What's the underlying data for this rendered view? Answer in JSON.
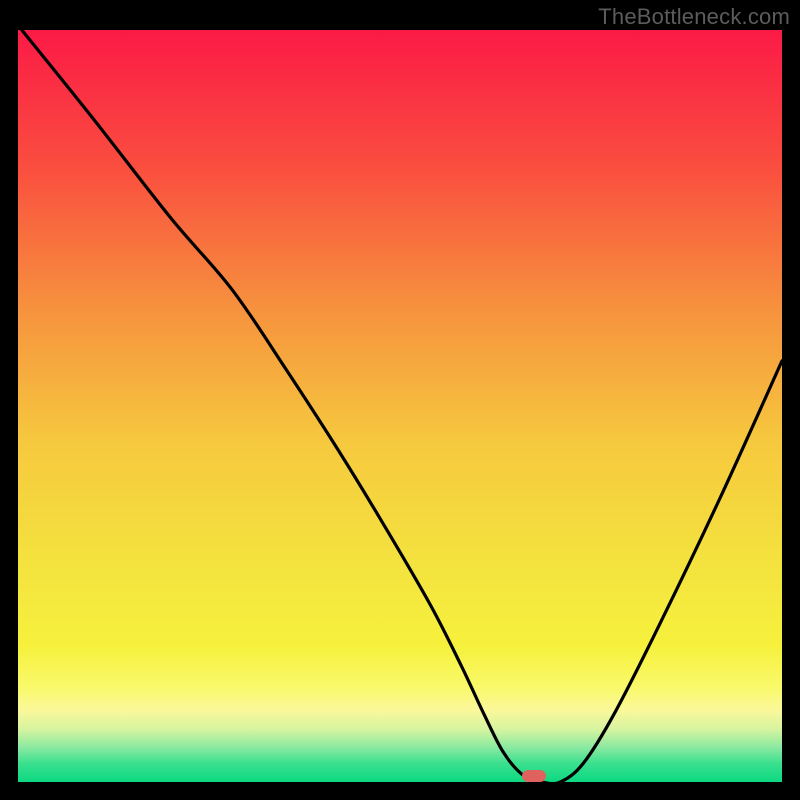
{
  "watermark": "TheBottleneck.com",
  "colors": {
    "gradient_stops": [
      {
        "offset": 0.0,
        "hex": "#fb1a46"
      },
      {
        "offset": 0.18,
        "hex": "#fa4d3f"
      },
      {
        "offset": 0.38,
        "hex": "#f6953e"
      },
      {
        "offset": 0.55,
        "hex": "#f6c93e"
      },
      {
        "offset": 0.7,
        "hex": "#f4e13e"
      },
      {
        "offset": 0.82,
        "hex": "#f6f13d"
      },
      {
        "offset": 0.875,
        "hex": "#f9f96c"
      },
      {
        "offset": 0.905,
        "hex": "#faf89a"
      },
      {
        "offset": 0.93,
        "hex": "#d6f4a0"
      },
      {
        "offset": 0.955,
        "hex": "#87e9a0"
      },
      {
        "offset": 0.975,
        "hex": "#3be08e"
      },
      {
        "offset": 1.0,
        "hex": "#0bd981"
      }
    ],
    "curve": "#000000",
    "marker": "#e0625e",
    "frame": "#000000",
    "watermark": "#5c5c5c"
  },
  "chart_data": {
    "type": "line",
    "title": "",
    "xlabel": "",
    "ylabel": "",
    "xlim": [
      0,
      100
    ],
    "ylim": [
      0,
      100
    ],
    "series": [
      {
        "name": "bottleneck-curve",
        "x": [
          0.5,
          10,
          20,
          28,
          35,
          42,
          48,
          54,
          58,
          61,
          63.5,
          66,
          68.5,
          71,
          74,
          78,
          84,
          92,
          100
        ],
        "y": [
          100,
          88,
          75,
          65.5,
          55,
          44,
          34,
          23.5,
          15.5,
          9,
          4,
          1,
          0,
          0,
          2.5,
          9,
          21,
          38,
          56
        ]
      }
    ],
    "marker": {
      "x": 67.5,
      "y": 0
    },
    "grid": false,
    "legend": false
  }
}
